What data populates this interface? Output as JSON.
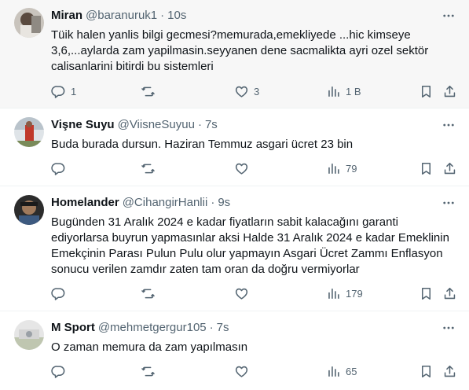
{
  "tweets": [
    {
      "name": "Miran",
      "handle": "@baranuruk1",
      "time": "10s",
      "text": "Tüik halen yanlis bilgi gecmesi?memurada,emekliyede ...hic kimseye 3,6,...aylarda zam yapilmasin.seyyanen dene sacmalikta ayri ozel sektör calisanlarini bitirdi bu sistemleri",
      "replies": "1",
      "retweets": "",
      "likes": "3",
      "views": "1 B"
    },
    {
      "name": "Vişne Suyu",
      "handle": "@ViisneSuyuu",
      "time": "7s",
      "text": "Buda burada dursun. Haziran Temmuz asgari ücret 23 bin",
      "replies": "",
      "retweets": "",
      "likes": "",
      "views": "79"
    },
    {
      "name": "Homelander",
      "handle": "@CihangirHanlii",
      "time": "9s",
      "text": "Bugünden 31 Aralık 2024 e kadar fiyatların sabit kalacağını garanti ediyorlarsa buyrun yapmasınlar aksi Halde 31 Aralık 2024 e kadar Emeklinin Emekçinin Parası Pulun Pulu olur yapmayın Asgari Ücret Zammı Enflasyon sonucu verilen zamdır zaten tam oran da doğru vermiyorlar",
      "replies": "",
      "retweets": "",
      "likes": "",
      "views": "179"
    },
    {
      "name": "M Sport",
      "handle": "@mehmetgergur105",
      "time": "7s",
      "text": "O zaman memura da zam yapılmasın",
      "replies": "",
      "retweets": "",
      "likes": "",
      "views": "65"
    }
  ],
  "separator": "·",
  "icons": {
    "more": "more-horizontal-icon",
    "reply": "reply-icon",
    "retweet": "retweet-icon",
    "like": "heart-icon",
    "views": "views-chart-icon",
    "bookmark": "bookmark-icon",
    "share": "share-icon"
  },
  "colors": {
    "text": "#0f1419",
    "muted": "#536471",
    "divider": "#eff3f4",
    "hover_bg": "#f7f7f7"
  }
}
